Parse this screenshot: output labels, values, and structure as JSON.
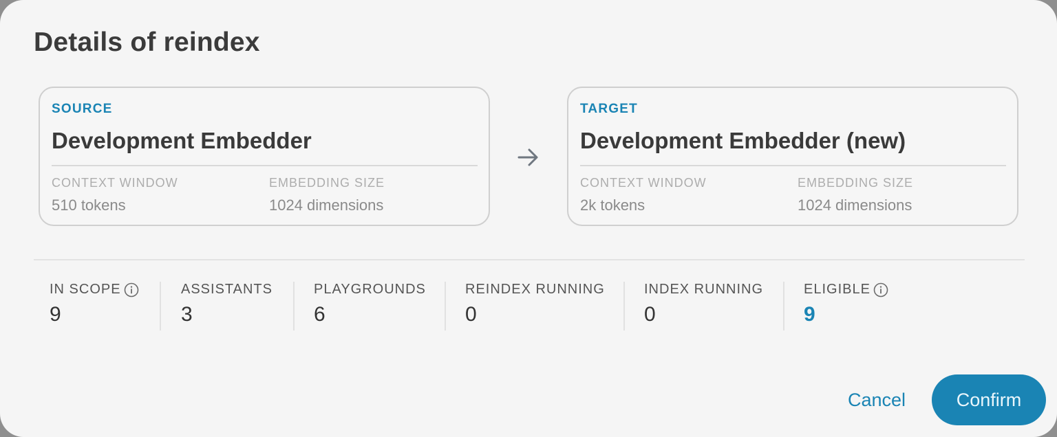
{
  "dialog": {
    "title": "Details of reindex"
  },
  "source": {
    "eyebrow": "SOURCE",
    "name": "Development Embedder",
    "context_window_label": "CONTEXT WINDOW",
    "context_window_value": "510 tokens",
    "embedding_size_label": "EMBEDDING SIZE",
    "embedding_size_value": "1024 dimensions"
  },
  "target": {
    "eyebrow": "TARGET",
    "name": "Development Embedder (new)",
    "context_window_label": "CONTEXT WINDOW",
    "context_window_value": "2k tokens",
    "embedding_size_label": "EMBEDDING SIZE",
    "embedding_size_value": "1024 dimensions"
  },
  "arrow_icon": "arrow-right-icon",
  "stats": [
    {
      "label": "IN SCOPE",
      "value": "9",
      "info": true
    },
    {
      "label": "ASSISTANTS",
      "value": "3"
    },
    {
      "label": "PLAYGROUNDS",
      "value": "6"
    },
    {
      "label": "REINDEX RUNNING",
      "value": "0"
    },
    {
      "label": "INDEX RUNNING",
      "value": "0"
    },
    {
      "label": "ELIGIBLE",
      "value": "9",
      "info": true,
      "accent": true
    }
  ],
  "actions": {
    "cancel_label": "Cancel",
    "confirm_label": "Confirm"
  },
  "colors": {
    "accent": "#1a84b4",
    "surface": "#f5f5f5",
    "text": "#3b3b3b",
    "muted": "#adadad"
  }
}
